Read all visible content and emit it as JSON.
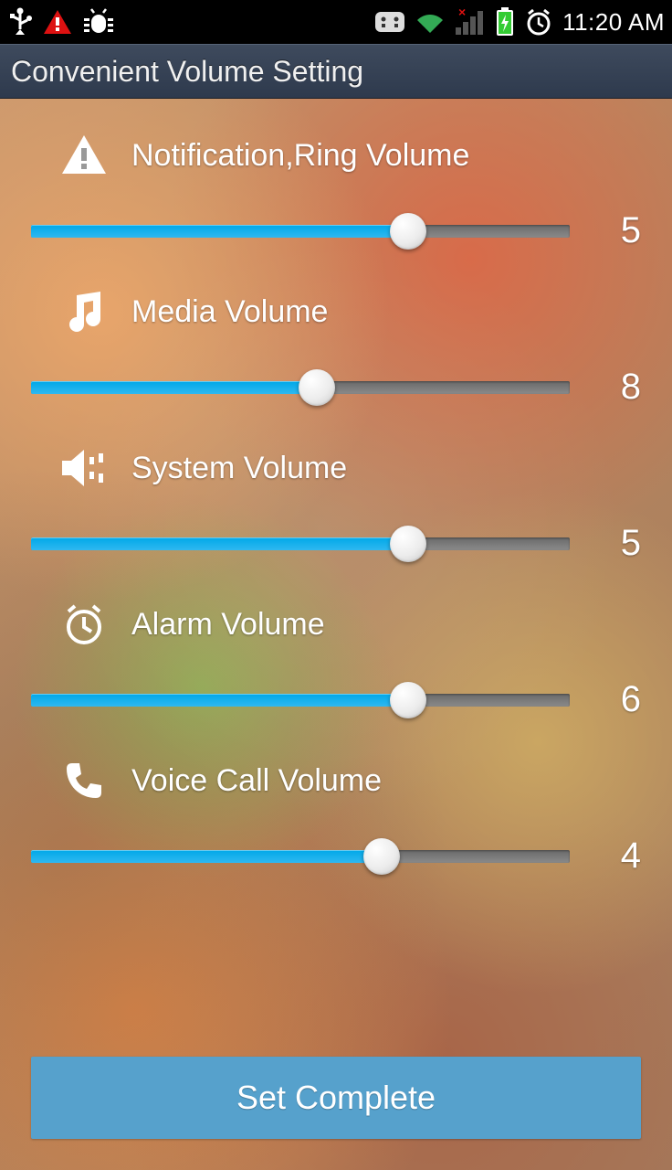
{
  "status": {
    "time": "11:20 AM"
  },
  "app": {
    "title": "Convenient Volume Setting"
  },
  "volumes": [
    {
      "id": "notification",
      "label": "Notification,Ring Volume",
      "value": 5,
      "max": 7,
      "percent": 70
    },
    {
      "id": "media",
      "label": "Media Volume",
      "value": 8,
      "max": 15,
      "percent": 53
    },
    {
      "id": "system",
      "label": "System Volume",
      "value": 5,
      "max": 7,
      "percent": 70
    },
    {
      "id": "alarm",
      "label": "Alarm Volume",
      "value": 6,
      "max": 7,
      "percent": 70
    },
    {
      "id": "voice",
      "label": "Voice Call Volume",
      "value": 4,
      "max": 6,
      "percent": 65
    }
  ],
  "button": {
    "set_complete": "Set Complete"
  }
}
